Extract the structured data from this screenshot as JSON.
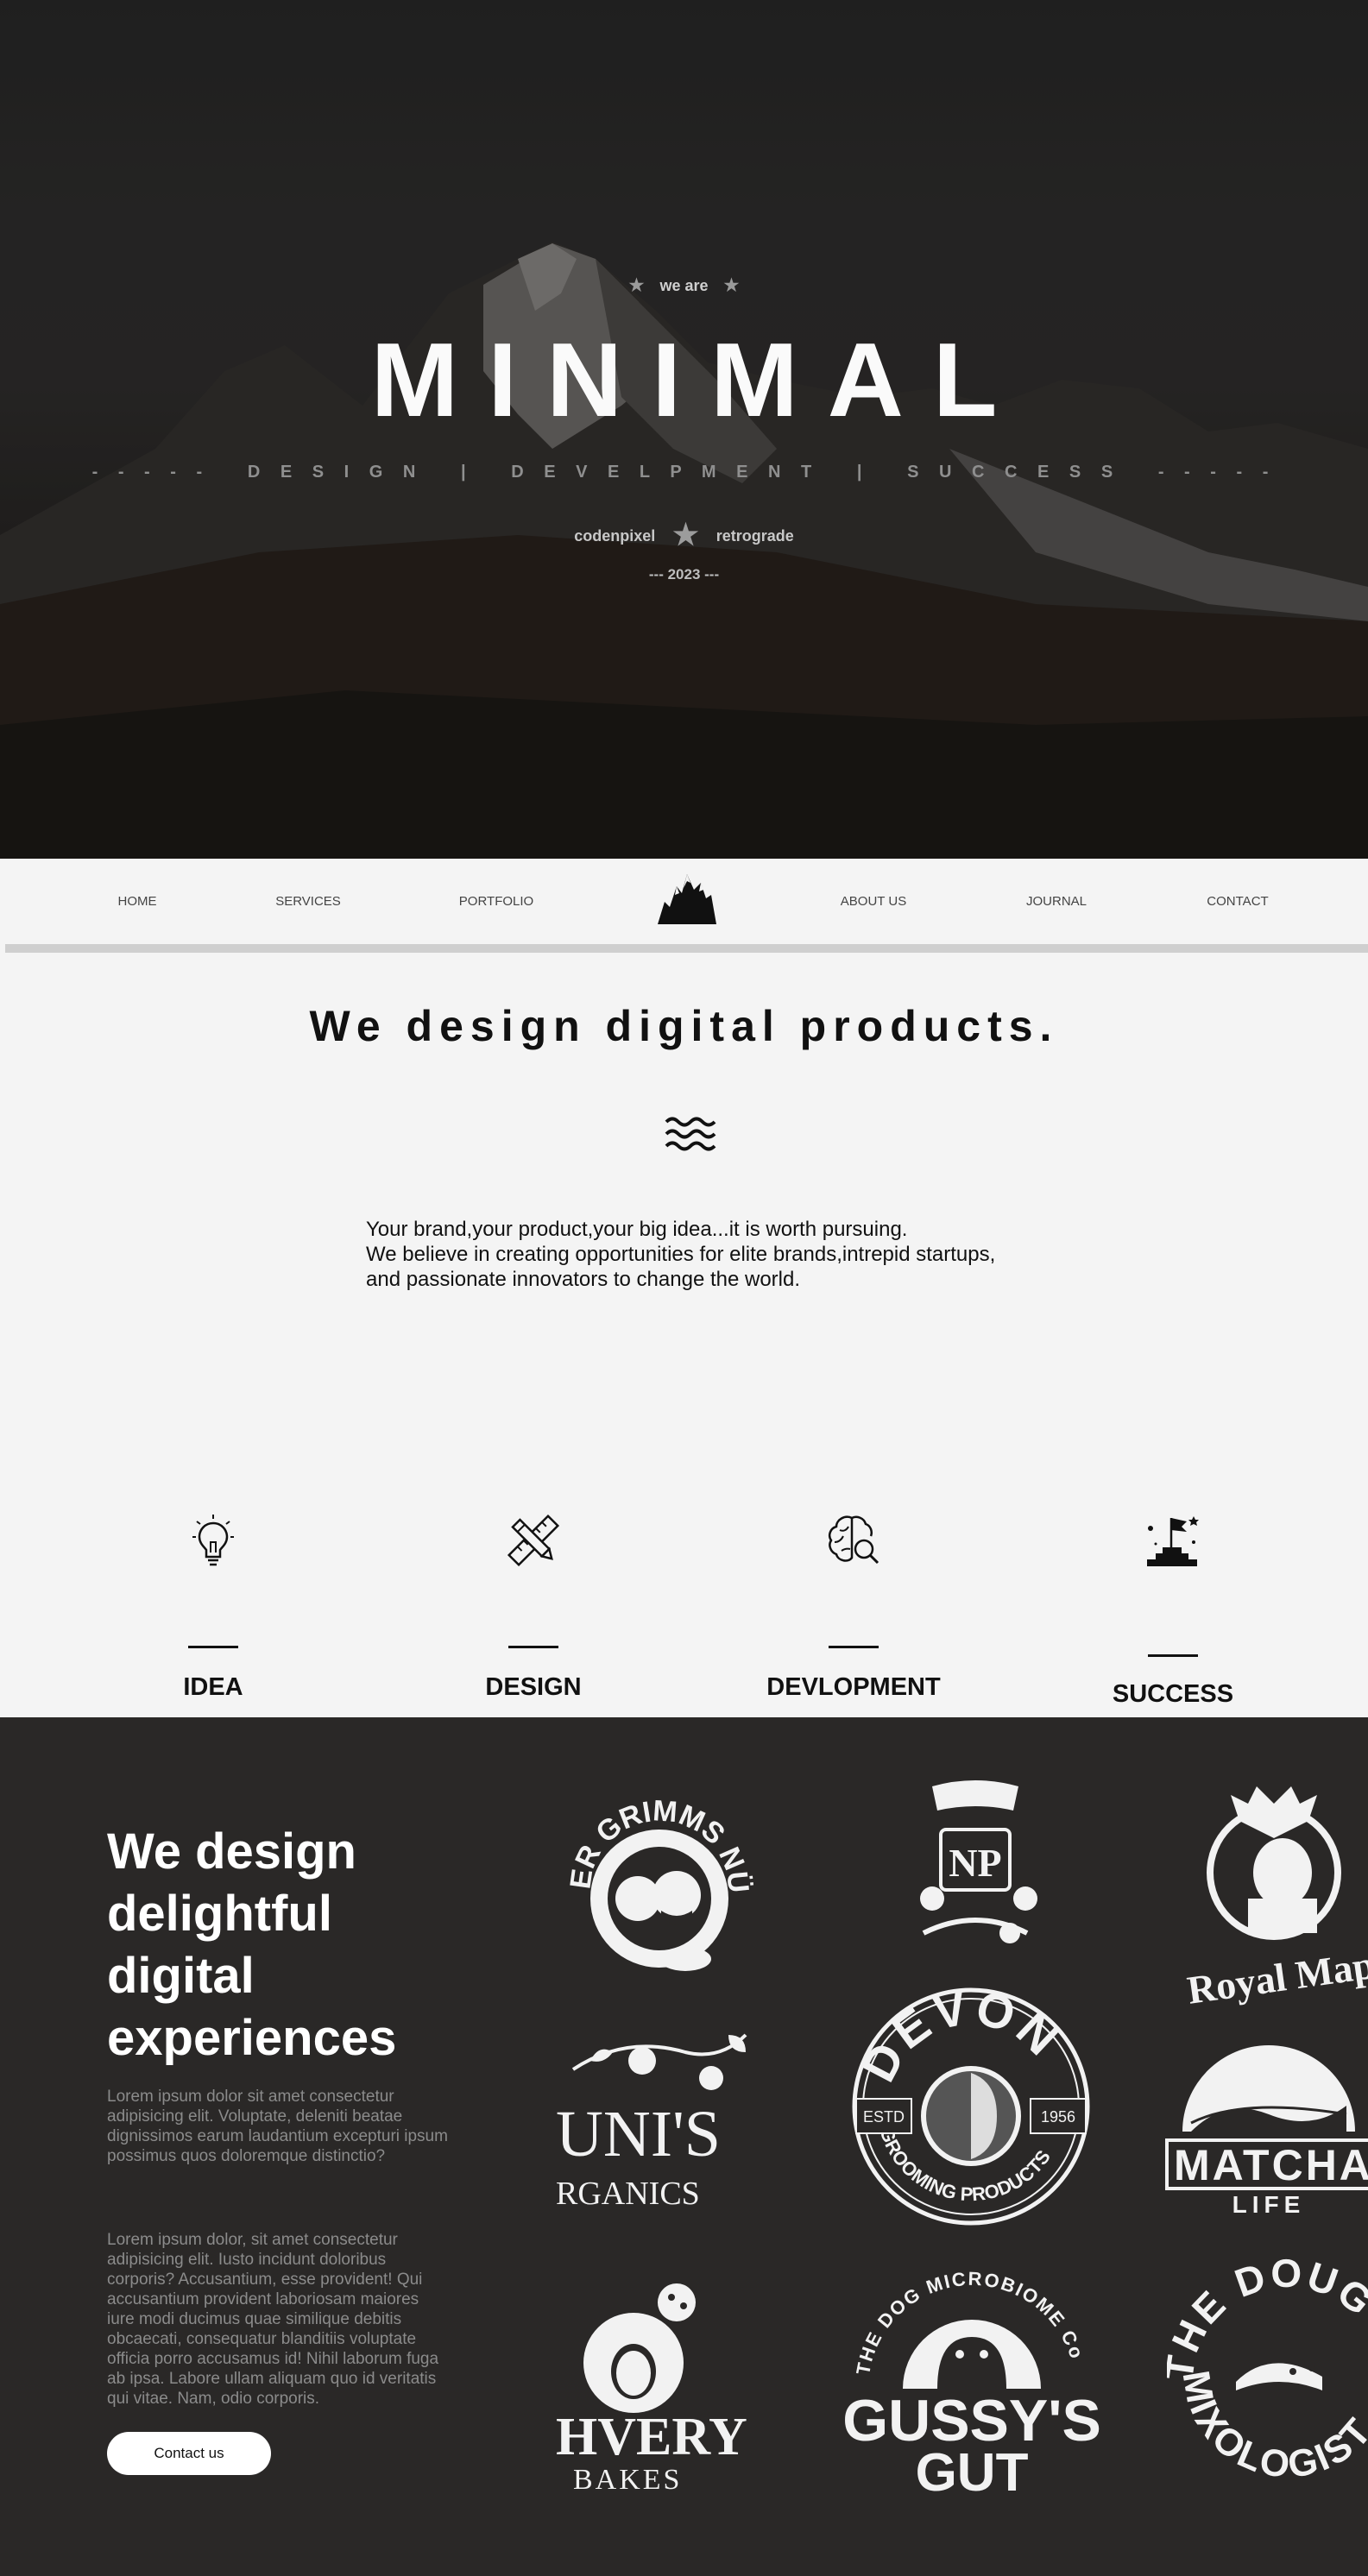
{
  "hero": {
    "eyebrow": "we are",
    "title": "MINIMAL",
    "tagline": "- - - - -   D E S I G N   |   D E V E L P M E N T   |   S U C C E S S   - - - - -",
    "credit_left": "codenpixel",
    "credit_right": "retrograde",
    "year": "--- 2023 ---",
    "star_glyph": "★"
  },
  "nav": {
    "items": [
      "HOME",
      "SERVICES",
      "PORTFOLIO",
      "ABOUT US",
      "JOURNAL",
      "CONTACT"
    ]
  },
  "intro": {
    "headline": "We design digital products.",
    "lines": [
      "Your brand,your product,your big idea...it is worth pursuing.",
      "We believe in creating opportunities for elite brands,intrepid startups,",
      "and passionate innovators to change the world."
    ]
  },
  "features": [
    {
      "label": "IDEA",
      "icon": "lightbulb-icon"
    },
    {
      "label": "DESIGN",
      "icon": "pencil-ruler-icon"
    },
    {
      "label": "DEVLOPMENT",
      "icon": "brain-search-icon"
    },
    {
      "label": "SUCCESS",
      "icon": "summit-flag-icon"
    }
  ],
  "showcase": {
    "heading": "We design delightful digital experiences",
    "paragraph_1": "Lorem ipsum dolor sit amet consectetur adipisicing elit. Voluptate, deleniti beatae dignissimos earum laudantium excepturi ipsum possimus quos doloremque distinctio?",
    "paragraph_2": "Lorem ipsum dolor, sit amet consectetur adipisicing elit. Iusto incidunt doloribus corporis? Accusantium, esse provident! Qui accusantium provident laboriosam maiores iure modi ducimus quae similique debitis obcaecati, consequatur blanditiis voluptate officia porro accusamus id! Nihil laborum fuga ab ipsa. Labore ullam aliquam quo id veritatis qui vitae. Nam, odio corporis.",
    "button_label": "Contact us",
    "logos": {
      "grimms": "ER GRIMMS NÜSSE",
      "np": "NP",
      "royal_maple": "Royal Mapl",
      "juni_1": "UNI'S",
      "juni_2": "RGANICS",
      "devon_top": "DEVON",
      "devon_bottom": "GROOMING PRODUCTS",
      "devon_estd": "ESTD",
      "devon_year": "1956",
      "matcha_1": "MATCHA",
      "matcha_2": "LIFE",
      "ahvery_1": "HVERY",
      "ahvery_2": "BAKES",
      "gussy_arc": "THE DOG MICROBIOME Co",
      "gussy_1": "GUSSY'S",
      "gussy_2": "GUT",
      "dough_1": "THE DOUG",
      "dough_2": "MIXOLOGIST"
    }
  }
}
